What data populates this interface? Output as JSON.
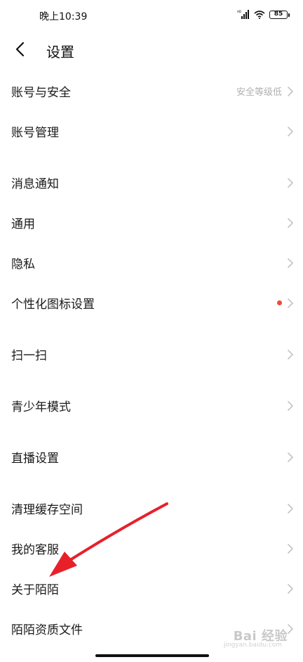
{
  "status_bar": {
    "time": "晚上10:39",
    "battery": "85"
  },
  "header": {
    "title": "设置"
  },
  "settings": {
    "items": [
      {
        "label": "账号与安全",
        "value": "安全等级低"
      },
      {
        "label": "账号管理"
      },
      {
        "label": "消息通知"
      },
      {
        "label": "通用"
      },
      {
        "label": "隐私"
      },
      {
        "label": "个性化图标设置"
      },
      {
        "label": "扫一扫"
      },
      {
        "label": "青少年模式"
      },
      {
        "label": "直播设置"
      },
      {
        "label": "清理缓存空间"
      },
      {
        "label": "我的客服"
      },
      {
        "label": "关于陌陌"
      },
      {
        "label": "陌陌资质文件"
      }
    ]
  },
  "watermark": {
    "brand": "Bai 经验",
    "url": "jingyan.baidu.com"
  },
  "colors": {
    "accent_dot": "#ef4a3c",
    "annotation_arrow": "#e8202a",
    "secondary_text": "#b0b0b0"
  }
}
